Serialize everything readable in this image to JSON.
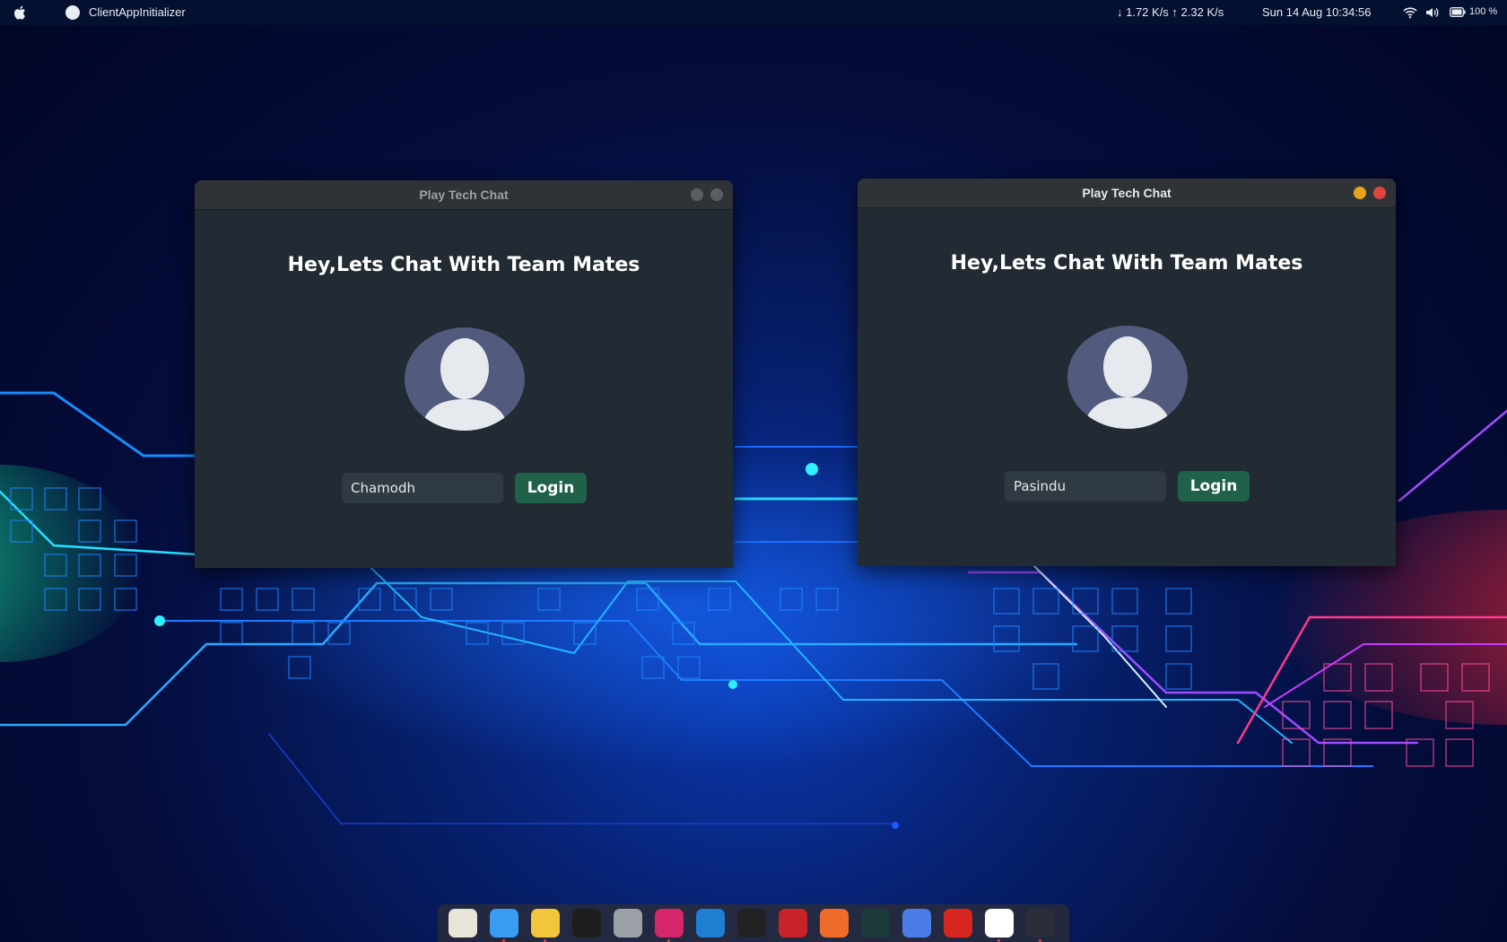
{
  "menubar": {
    "app_name": "ClientAppInitializer",
    "net_speed": "↓ 1.72 K/s ↑ 2.32 K/s",
    "clock": "Sun 14 Aug  10:34:56",
    "battery": "100 %"
  },
  "windows": [
    {
      "title": "Play Tech Chat",
      "heading": "Hey,Lets Chat With Team Mates",
      "username_value": "Chamodh",
      "login_label": "Login",
      "active": false
    },
    {
      "title": "Play Tech Chat",
      "heading": "Hey,Lets Chat With Team Mates",
      "username_value": "Pasindu",
      "login_label": "Login",
      "active": true
    }
  ],
  "colors": {
    "window_bg": "#222b33",
    "login_button": "#1f6149",
    "avatar_bg": "#525b7e",
    "minimize": "#e8a11a",
    "close": "#e0443e"
  },
  "dock": {
    "items": [
      {
        "name": "launchpad-icon",
        "color": "#e9e4d8",
        "running": false
      },
      {
        "name": "finder-icon",
        "color": "#3a9cf0",
        "running": true
      },
      {
        "name": "chrome-icon",
        "color": "#f2c53d",
        "running": true
      },
      {
        "name": "terminal-icon",
        "color": "#1e1e1e",
        "running": false
      },
      {
        "name": "settings-icon",
        "color": "#9aa0a6",
        "running": false
      },
      {
        "name": "intellij-icon",
        "color": "#d6266a",
        "running": true
      },
      {
        "name": "vscode-icon",
        "color": "#1f7ed1",
        "running": false
      },
      {
        "name": "obs-icon",
        "color": "#222222",
        "running": false
      },
      {
        "name": "filezilla-icon",
        "color": "#c8222a",
        "running": false
      },
      {
        "name": "postman-icon",
        "color": "#ef6b2a",
        "running": false
      },
      {
        "name": "system-monitor-icon",
        "color": "#1c3a3a",
        "running": false
      },
      {
        "name": "zoom-icon",
        "color": "#4a7ee6",
        "running": false
      },
      {
        "name": "pdf-reader-icon",
        "color": "#d7261f",
        "running": false
      },
      {
        "name": "play-tech-chat-icon",
        "color": "#ffffff",
        "running": true
      },
      {
        "name": "play-tech-chat-2-icon",
        "color": "#2a2e3a",
        "running": true
      }
    ]
  }
}
